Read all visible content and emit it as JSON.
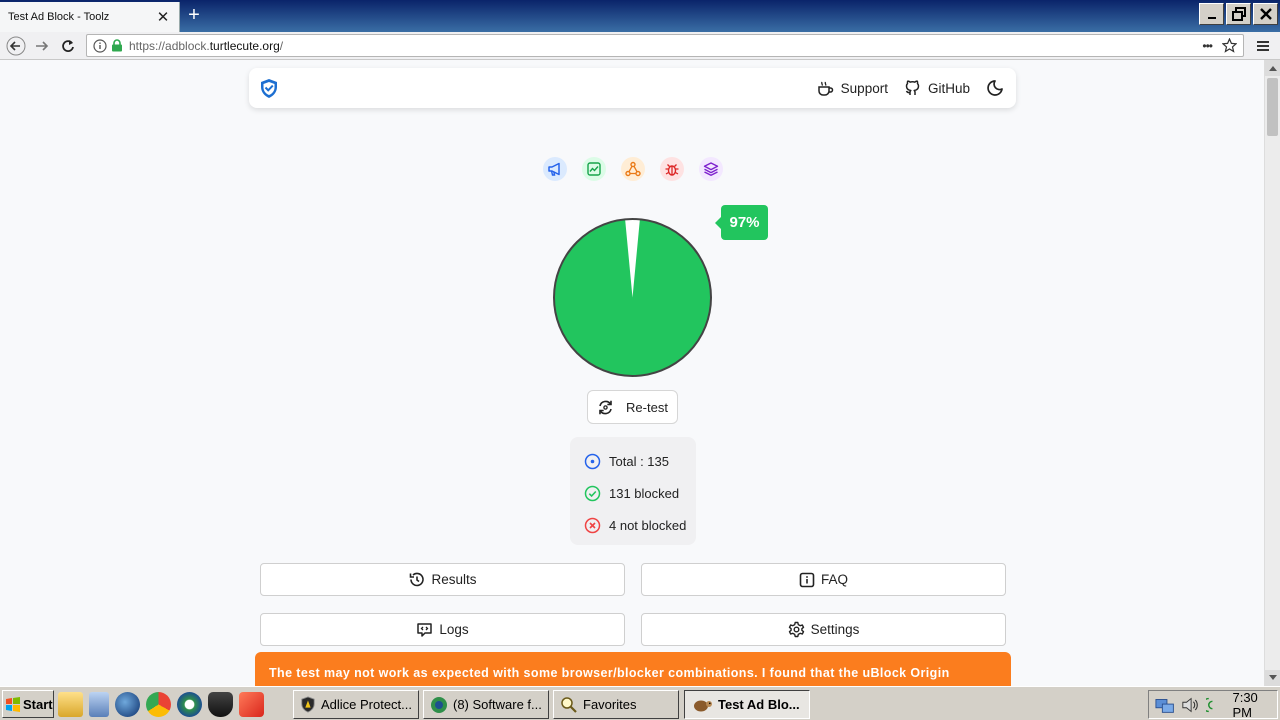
{
  "browser": {
    "tab_title": "Test Ad Block - Toolz",
    "tab_close": "✕",
    "new_tab": "+",
    "url_scheme": "https://adblock.",
    "url_host": "turtlecute.org",
    "url_path": "/",
    "page_actions": "•••"
  },
  "header": {
    "support_label": "Support",
    "github_label": "GitHub"
  },
  "result": {
    "percent_label": "97%",
    "blocked_fraction": 0.97,
    "retest_label": "Re-test"
  },
  "stats": {
    "total": "Total : 135",
    "blocked": "131 blocked",
    "not_blocked": "4 not blocked"
  },
  "buttons": {
    "results": "Results",
    "faq": "FAQ",
    "logs": "Logs",
    "settings": "Settings"
  },
  "warning": {
    "text": "The test may not work as expected with some browser/blocker combinations. I found that the uBlock Origin"
  },
  "colors": {
    "success": "#22c55e",
    "danger": "#ef4444",
    "info": "#2563eb",
    "warning": "#fb7d1e"
  },
  "taskbar": {
    "start_label": "Start",
    "tasks": [
      "Adlice Protect...",
      "(8) Software f...",
      "Favorites",
      "Test Ad Blo..."
    ],
    "clock": "7:30 PM"
  }
}
